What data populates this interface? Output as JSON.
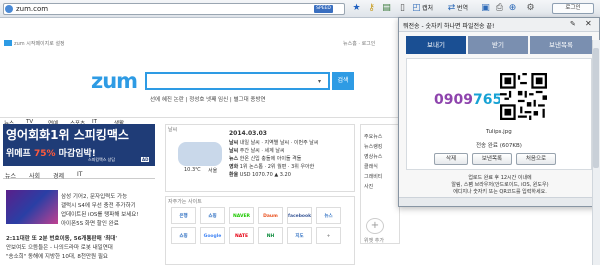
{
  "browser": {
    "url": "zum.com",
    "speed_badge": "SPEED",
    "toolbar": {
      "capture_label": "캡처",
      "translate_label": "번역",
      "login_label": "로그인"
    }
  },
  "page": {
    "top_links_left": "zum 시작페이지로 설정",
    "top_links_right": "뉴스홈 · 로그인",
    "logo": "zum",
    "search": {
      "value": "",
      "button": "검색",
      "dropdown": "▾"
    },
    "hot_links": "선에 혜진 논란 | 정성호 넷째 임신 | 별그대 종방연",
    "nav_items": [
      "뉴스",
      "TV",
      "연예",
      "스포츠",
      "IT",
      "생활"
    ],
    "ad": {
      "line1": "영어회화1위 스피킹맥스",
      "line2_prefix": "위메프",
      "line2_pct": "75%",
      "line2_suffix": "마감임박!",
      "tag": "AD",
      "sub": "스피킹맥스 상담"
    },
    "news_tabs": [
      "뉴스",
      "사회",
      "경제",
      "IT"
    ],
    "news_items": [
      "삼성 기어2, 문자입력도 가능",
      "갤럭시 S4에 무선 충전 추가하기",
      "업데이트된 iOS를 탱파해 보세요!",
      "아이폰5S 화면 할인 완료"
    ],
    "headlines": [
      "2:11대란 또 2분 번호이동, 56개통판매 '최대'",
      "안보여도 으뜸들은 - 나의드라마 로봇 내일연대",
      "\"송소희\" 동해에 지방한 10대, 8천만원 필요"
    ],
    "weather": {
      "section_label": "날씨",
      "date": "2014.03.03",
      "rows": [
        {
          "key": "날씨",
          "value": "내일 날씨 · 지역별 날씨 · 이번주 날씨"
        },
        {
          "key": "날씨",
          "value": "주간 날씨 · 세계 날씨"
        },
        {
          "key": "뉴스",
          "value": "한온 신입 충돌에 아이돌 격돌"
        },
        {
          "key": "영화",
          "value": "1위 논스톱 · 2위 월편 · 3위 우아한"
        },
        {
          "key": "환율",
          "value": "USD 1070.70 ▲ 3.20"
        }
      ],
      "temp": "10.3℃",
      "place": "서울",
      "condition": "흐림"
    },
    "shortcuts_label": "자주가는 사이트",
    "shortcuts": [
      "은행",
      "쇼핑",
      "NAVER",
      "Daum",
      "facebook",
      "뉴스",
      "쇼핑",
      "Google",
      "NATE",
      "NH",
      "지도",
      "+"
    ],
    "widget_label": "위젯 추가",
    "right_links": [
      "주요뉴스",
      "뉴스랭킹",
      "영상뉴스",
      "클래식",
      "그래비티",
      "사진"
    ]
  },
  "popup": {
    "title": "뭐전송 - 숫자키 하나면 파일전송 끝!",
    "tabs": [
      "보내기",
      "받기",
      "보낸목록"
    ],
    "active_tab": 0,
    "code_part1": "0909",
    "code_part2": "7651",
    "filename": "Tulips.jpg",
    "status": "전송 완료 (607KB)",
    "buttons": [
      "삭제",
      "보낸목록",
      "처음으로"
    ],
    "footer_line1": "업로드 완료 후 12시간 이내에",
    "footer_line2": "알림, 스팸 브라우저(안드로이드, iOS, 윈도우)",
    "footer_line3": "에디지나 숫자키 또는 QR코드를 입력하세요.",
    "bottom_bar": "",
    "colors": {
      "tab_active": "#1a4f93",
      "tab_inactive": "#7a8fb0",
      "code_purple": "#8e44ad",
      "code_blue": "#17a2d4"
    }
  }
}
